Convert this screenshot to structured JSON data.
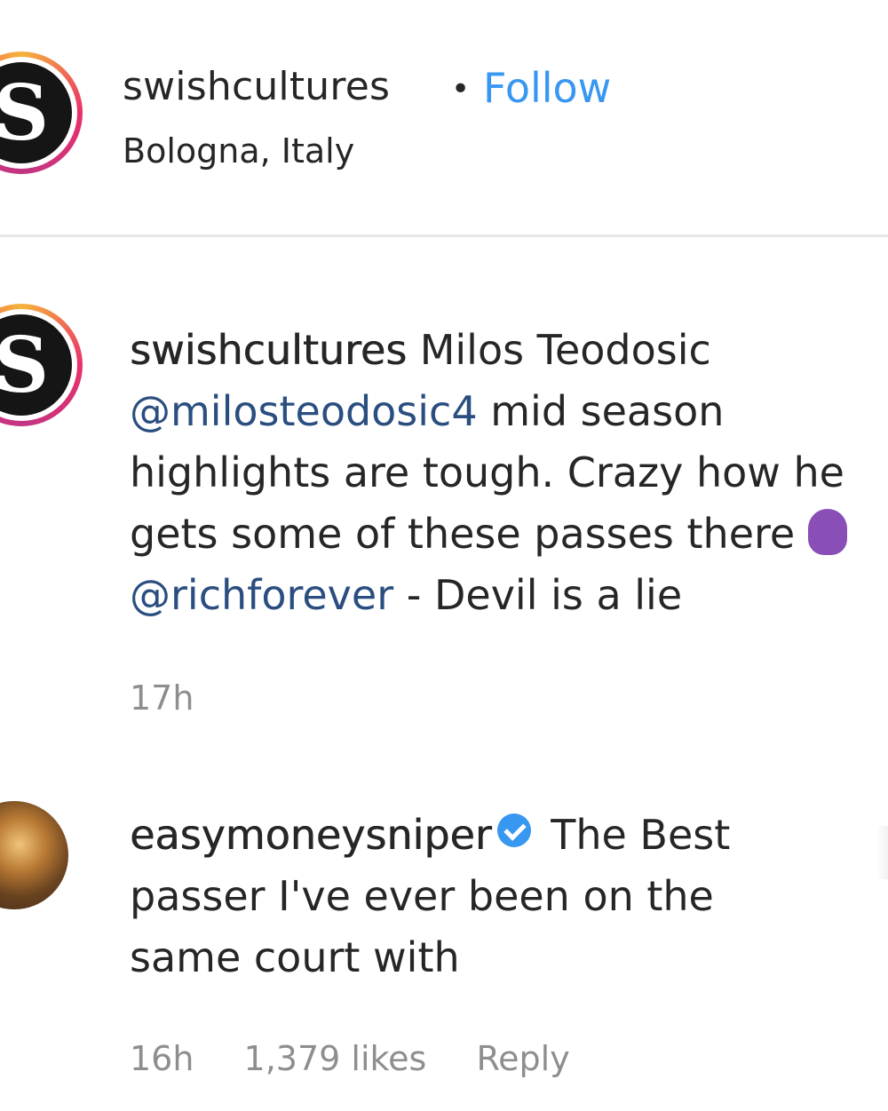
{
  "header": {
    "username": "swishcultures",
    "separator": "•",
    "follow_label": "Follow",
    "location": "Bologna, Italy",
    "avatar_glyph": "S"
  },
  "caption": {
    "username": "swishcultures",
    "avatar_glyph": "S",
    "line1_text": " Milos Teodosic",
    "line2_mention": "@milosteodosic4",
    "line2_text": " mid season",
    "line3_text": "highlights are tough. Crazy how he",
    "line4_text": "gets some of these passes there ",
    "line5_mention": "@richforever",
    "line5_text": " - Devil is a lie",
    "time": "17h"
  },
  "reply": {
    "username": "easymoneysniper",
    "line1_text": " The Best",
    "line2_text": "passer I've ever been on the",
    "line3_text": "same court with",
    "time": "16h",
    "likes": "1,379 likes",
    "reply_label": "Reply"
  },
  "icons": {
    "verified": "verified-badge-icon",
    "emoji": "purple-emoji-icon"
  },
  "colors": {
    "link": "#3897f0",
    "mention": "#2a4e7f",
    "muted": "#8e8e8e",
    "text": "#262626"
  }
}
